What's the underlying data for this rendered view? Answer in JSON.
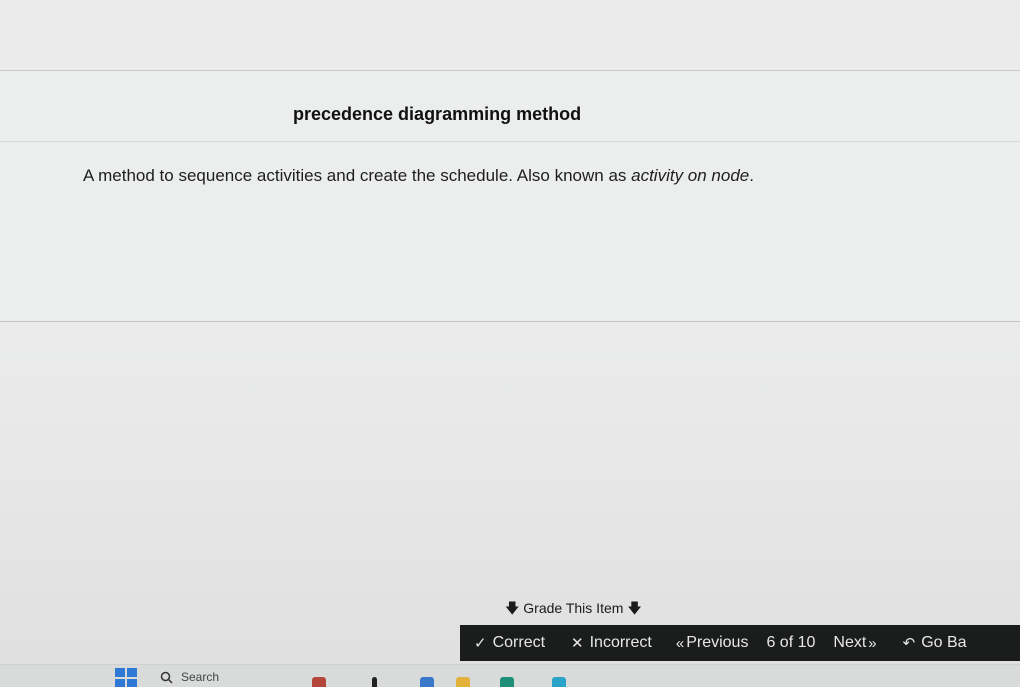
{
  "card": {
    "term": "precedence diagramming method",
    "definition_text": "A method to sequence activities and create the schedule. Also known as ",
    "definition_italic": "activity on node",
    "definition_end": "."
  },
  "grade": {
    "label": "Grade This Item"
  },
  "toolbar": {
    "correct_label": "Correct",
    "incorrect_label": "Incorrect",
    "previous_label": "Previous",
    "counter": "6 of 10",
    "next_label": "Next",
    "go_back_label": "Go Ba"
  },
  "taskbar": {
    "search_placeholder": "Search"
  },
  "colors": {
    "toolbar_bg": "#1b1c1c",
    "toolbar_text": "#e7e7e7",
    "windows_accent": "#2e78d6"
  }
}
